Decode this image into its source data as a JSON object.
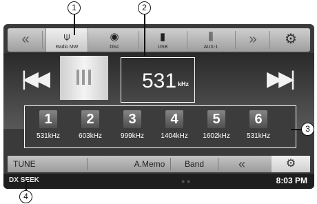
{
  "callouts": [
    "1",
    "2",
    "3",
    "4"
  ],
  "topbar": {
    "prev_arrow": "«",
    "next_arrow": "»",
    "sources": [
      {
        "label": "Radio MW",
        "icon": "antenna-icon",
        "glyph": "⍦"
      },
      {
        "label": "Disc",
        "icon": "disc-icon",
        "glyph": "◉"
      },
      {
        "label": "USB",
        "icon": "usb-icon",
        "glyph": "▮"
      },
      {
        "label": "AUX-1",
        "icon": "aux-icon",
        "glyph": "⫼"
      }
    ],
    "setup_icon_glyph": "⚙"
  },
  "main": {
    "prev_glyph": "|◀◀",
    "next_glyph": "▶▶|",
    "frequency": "531",
    "unit": "kHz"
  },
  "presets": [
    {
      "number": "1",
      "freq": "531kHz"
    },
    {
      "number": "2",
      "freq": "603kHz"
    },
    {
      "number": "3",
      "freq": "999kHz"
    },
    {
      "number": "4",
      "freq": "1404kHz"
    },
    {
      "number": "5",
      "freq": "1602kHz"
    },
    {
      "number": "6",
      "freq": "531kHz"
    }
  ],
  "bottombar": {
    "tune": "TUNE",
    "amemo": "A.Memo",
    "band": "Band",
    "back": "«",
    "setup_glyph": "⚙"
  },
  "status": {
    "mode": "DX SEEK",
    "time": "8:03 PM"
  }
}
